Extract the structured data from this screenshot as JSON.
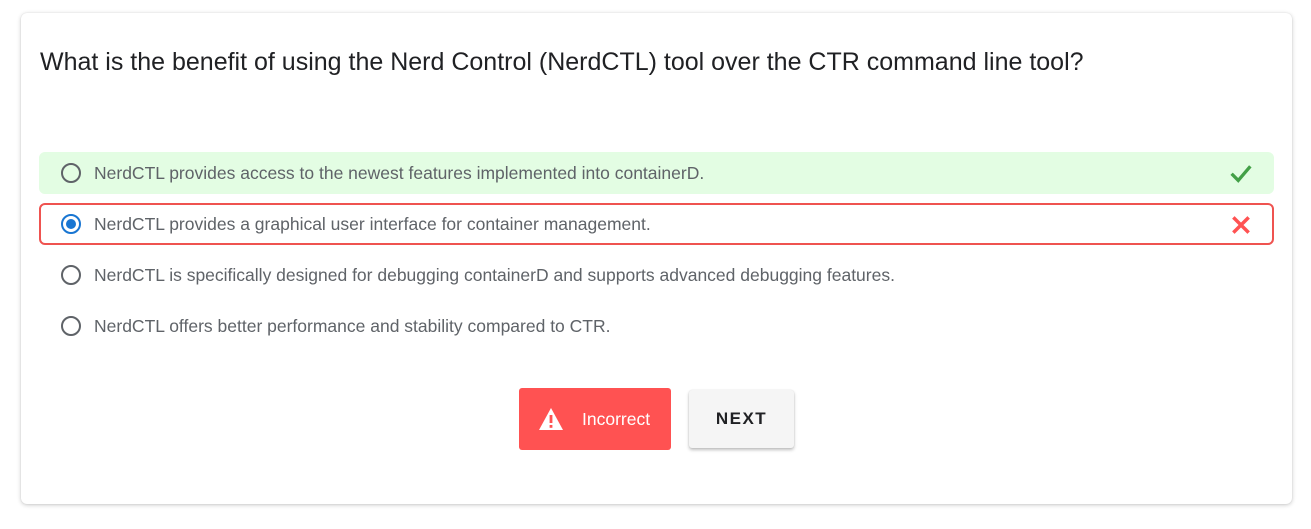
{
  "question": {
    "text": "What is the benefit of using the Nerd Control (NerdCTL) tool over the CTR command line tool?"
  },
  "options": [
    {
      "label": "NerdCTL provides access to the newest features implemented into containerD.",
      "selected": false,
      "status": "correct"
    },
    {
      "label": "NerdCTL provides a graphical user interface for container management.",
      "selected": true,
      "status": "incorrect"
    },
    {
      "label": "NerdCTL is specifically designed for debugging containerD and supports advanced debugging features.",
      "selected": false,
      "status": "none"
    },
    {
      "label": "NerdCTL offers better performance and stability compared to CTR.",
      "selected": false,
      "status": "none"
    }
  ],
  "feedback": {
    "label": "Incorrect",
    "icon": "warning-icon"
  },
  "actions": {
    "next_label": "NEXT"
  },
  "colors": {
    "correct_bg": "#e3fde3",
    "correct_check": "#43a047",
    "incorrect_border": "#ef5350",
    "incorrect_x": "#ff5252",
    "radio_selected": "#1976d2",
    "incorrect_button": "#ff5252"
  }
}
